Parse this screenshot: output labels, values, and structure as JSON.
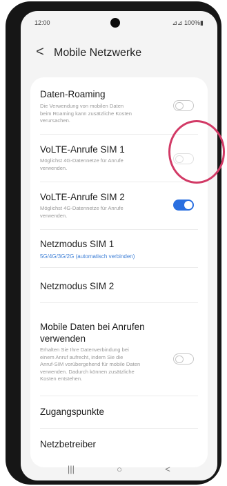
{
  "status_bar": {
    "time": "12:00",
    "right": "⊿⊿ 100%▮"
  },
  "header": {
    "back_glyph": "<",
    "title": "Mobile Netzwerke"
  },
  "items": {
    "data_roaming": {
      "title": "Daten-Roaming",
      "desc_lines": [
        "Die Verwendung von mobilen Daten",
        "beim Roaming kann zusätzliche Kosten",
        "verursachen."
      ],
      "toggle": "off"
    },
    "volte_sim1": {
      "title": "VoLTE-Anrufe SIM 1",
      "desc_lines": [
        "Möglichst 4G-Datennetze für Anrufe",
        "verwenden."
      ],
      "toggle": "off"
    },
    "volte_sim2": {
      "title": "VoLTE-Anrufe SIM 2",
      "desc_lines": [
        "Möglichst 4G-Datennetze für Anrufe",
        "verwenden."
      ],
      "toggle": "on"
    },
    "netzmodus_sim1": {
      "title": "Netzmodus SIM 1",
      "subtitle": "5G/4G/3G/2G (automatisch verbinden)"
    },
    "netzmodus_sim2": {
      "title": "Netzmodus SIM 2"
    },
    "mobile_daten_anrufe": {
      "title_lines": [
        "Mobile Daten bei Anrufen",
        "verwenden"
      ],
      "desc_lines": [
        "Erhalten Sie Ihre Datenverbindung bei",
        "einem Anruf aufrecht, indem Sie die",
        "Anruf-SIM vorübergehend für mobile Daten",
        "verwenden. Dadurch können zusätzliche",
        "Kosten entstehen."
      ],
      "toggle": "off"
    },
    "zugangspunkte": {
      "title": "Zugangspunkte"
    },
    "netzbetreiber": {
      "title": "Netzbetreiber"
    }
  },
  "navbar": {
    "recents": "|||",
    "home": "○",
    "back": "<"
  },
  "colors": {
    "accent": "#2a6fe0",
    "highlight": "#d23a66",
    "subtitle_blue": "#3e7fd6"
  }
}
